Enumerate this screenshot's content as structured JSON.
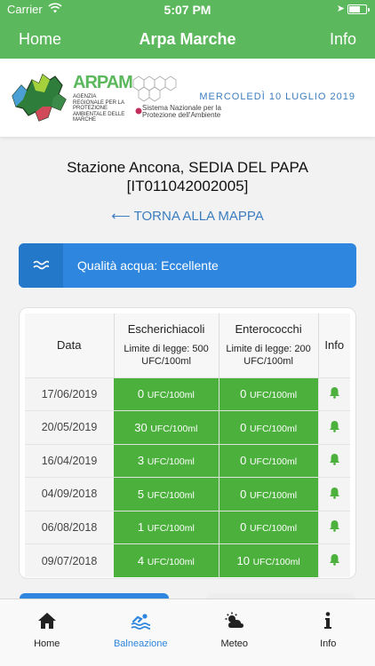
{
  "status_bar": {
    "carrier": "Carrier",
    "time": "5:07 PM"
  },
  "nav": {
    "left": "Home",
    "title": "Arpa Marche",
    "right": "Info"
  },
  "header": {
    "logo_text": "ARPAM",
    "agency_lines": "AGENZIA REGIONALE PER LA PROTEZIONE AMBIENTALE DELLE MARCHE",
    "network_text": "Sistema Nazionale per la Protezione dell'Ambiente",
    "date": "MERCOLEDÌ 10 LUGLIO 2019"
  },
  "station": {
    "name": "Stazione Ancona, SEDIA DEL PAPA",
    "code": "[IT011042002005]"
  },
  "back_link": "TORNA ALLA MAPPA",
  "quality": {
    "label": "Qualità acqua: Eccellente",
    "color": "#2e86de"
  },
  "table": {
    "headers": {
      "date": "Data",
      "ecoli": "Escherichiacoli",
      "ecoli_limit": "Limite di legge: 500 UFC/100ml",
      "entero": "Enterococchi",
      "entero_limit": "Limite di legge: 200 UFC/100ml",
      "info": "Info"
    },
    "unit": "UFC/100ml",
    "rows": [
      {
        "date": "17/06/2019",
        "ecoli": "0",
        "entero": "0"
      },
      {
        "date": "20/05/2019",
        "ecoli": "30",
        "entero": "0"
      },
      {
        "date": "16/04/2019",
        "ecoli": "3",
        "entero": "0"
      },
      {
        "date": "04/09/2018",
        "ecoli": "5",
        "entero": "0"
      },
      {
        "date": "06/08/2018",
        "ecoli": "1",
        "entero": "0"
      },
      {
        "date": "09/07/2018",
        "ecoli": "4",
        "entero": "10"
      }
    ],
    "good_color": "#4cb03d"
  },
  "tabs": [
    {
      "label": "Home",
      "icon": "house-icon"
    },
    {
      "label": "Balneazione",
      "icon": "swimmer-icon",
      "active": true
    },
    {
      "label": "Meteo",
      "icon": "weather-icon"
    },
    {
      "label": "Info",
      "icon": "info-icon"
    }
  ]
}
